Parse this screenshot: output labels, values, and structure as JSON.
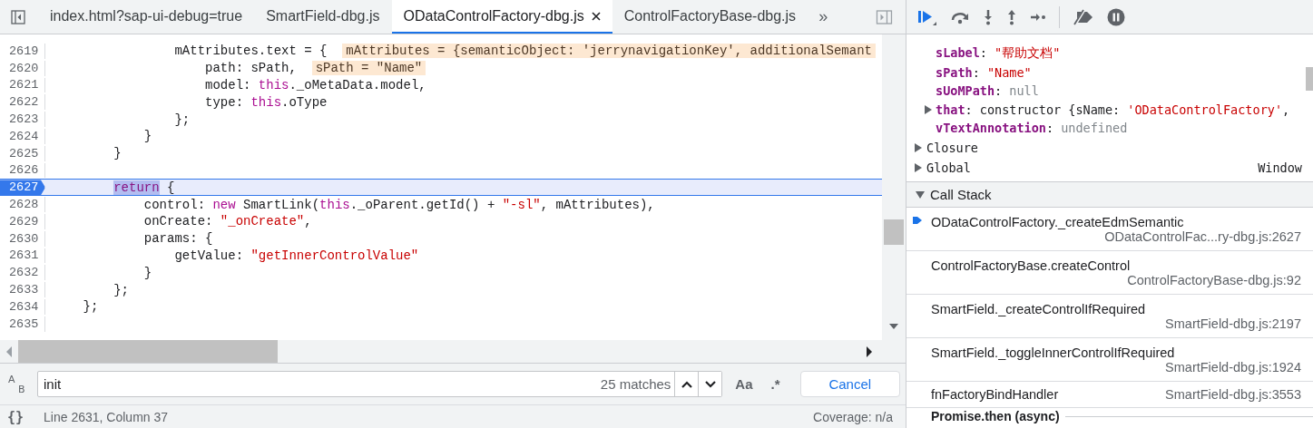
{
  "tabs": [
    {
      "label": "index.html?sap-ui-debug=true",
      "selected": false,
      "closable": false
    },
    {
      "label": "SmartField-dbg.js",
      "selected": false,
      "closable": false
    },
    {
      "label": "ODataControlFactory-dbg.js",
      "selected": true,
      "closable": true
    },
    {
      "label": "ControlFactoryBase-dbg.js",
      "selected": false,
      "closable": false
    }
  ],
  "more_tabs": "»",
  "code": [
    {
      "number": "2619",
      "paused": false,
      "breakpoint": false,
      "tokens": [
        {
          "kind": "plain",
          "text": "                mAttributes.text = {  "
        },
        {
          "kind": "inline",
          "text": "mAttributes = {semanticObject: 'jerrynavigationKey', additionalSemant"
        }
      ]
    },
    {
      "number": "2620",
      "paused": false,
      "breakpoint": false,
      "tokens": [
        {
          "kind": "plain",
          "text": "                    path: sPath,  "
        },
        {
          "kind": "inline",
          "text": "sPath = \"Name\""
        }
      ]
    },
    {
      "number": "2621",
      "paused": false,
      "breakpoint": false,
      "tokens": [
        {
          "kind": "plain",
          "text": "                    model: "
        },
        {
          "kind": "keyword",
          "text": "this"
        },
        {
          "kind": "plain",
          "text": "._oMetaData.model,"
        }
      ]
    },
    {
      "number": "2622",
      "paused": false,
      "breakpoint": false,
      "tokens": [
        {
          "kind": "plain",
          "text": "                    type: "
        },
        {
          "kind": "keyword",
          "text": "this"
        },
        {
          "kind": "plain",
          "text": ".oType"
        }
      ]
    },
    {
      "number": "2623",
      "paused": false,
      "breakpoint": false,
      "tokens": [
        {
          "kind": "plain",
          "text": "                };"
        }
      ]
    },
    {
      "number": "2624",
      "paused": false,
      "breakpoint": false,
      "tokens": [
        {
          "kind": "plain",
          "text": "            }"
        }
      ]
    },
    {
      "number": "2625",
      "paused": false,
      "breakpoint": false,
      "tokens": [
        {
          "kind": "plain",
          "text": "        }"
        }
      ]
    },
    {
      "number": "2626",
      "paused": false,
      "breakpoint": false
    },
    {
      "number": "2627",
      "paused": true,
      "breakpoint": true,
      "tokens": [
        {
          "kind": "match",
          "text": "        return"
        },
        {
          "kind": "plain",
          "text": " {"
        }
      ]
    },
    {
      "number": "2628",
      "paused": false,
      "breakpoint": false,
      "tokens": [
        {
          "kind": "plain",
          "text": "            control: "
        },
        {
          "kind": "keyword",
          "text": "new"
        },
        {
          "kind": "plain",
          "text": " SmartLink("
        },
        {
          "kind": "keyword",
          "text": "this"
        },
        {
          "kind": "plain",
          "text": "._oParent.getId() + "
        },
        {
          "kind": "string",
          "text": "\"-sl\""
        },
        {
          "kind": "plain",
          "text": ", mAttributes),"
        }
      ]
    },
    {
      "number": "2629",
      "paused": false,
      "breakpoint": false,
      "tokens": [
        {
          "kind": "plain",
          "text": "            onCreate: "
        },
        {
          "kind": "string",
          "text": "\"_onCreate\""
        },
        {
          "kind": "plain",
          "text": ","
        }
      ]
    },
    {
      "number": "2630",
      "paused": false,
      "breakpoint": false,
      "tokens": [
        {
          "kind": "plain",
          "text": "            params: {"
        }
      ]
    },
    {
      "number": "2631",
      "paused": false,
      "breakpoint": false,
      "tokens": [
        {
          "kind": "plain",
          "text": "                getValue: "
        },
        {
          "kind": "string",
          "text": "\"getInnerControlValue\""
        }
      ]
    },
    {
      "number": "2632",
      "paused": false,
      "breakpoint": false,
      "tokens": [
        {
          "kind": "plain",
          "text": "            }"
        }
      ]
    },
    {
      "number": "2633",
      "paused": false,
      "breakpoint": false,
      "tokens": [
        {
          "kind": "plain",
          "text": "        };"
        }
      ]
    },
    {
      "number": "2634",
      "paused": false,
      "breakpoint": false,
      "tokens": [
        {
          "kind": "plain",
          "text": "    };"
        }
      ]
    },
    {
      "number": "2635",
      "paused": false,
      "breakpoint": false
    }
  ],
  "search": {
    "replace_toggle": [
      "A",
      "B"
    ],
    "value": "init",
    "matches": "25 matches",
    "case_button": "Aa",
    "regex_button": ".*",
    "cancel": "Cancel"
  },
  "status_bar": {
    "format_button": "{}",
    "position": "Line 2631, Column 37",
    "coverage": "Coverage: n/a"
  },
  "scope": [
    {
      "name": "sLabel",
      "expandable": false,
      "value": [
        {
          "kind": "plain",
          "text": ": "
        },
        {
          "kind": "string",
          "text": "\"帮助文档\""
        }
      ]
    },
    {
      "name": "sPath",
      "expandable": false,
      "value": [
        {
          "kind": "plain",
          "text": ": "
        },
        {
          "kind": "string",
          "text": "\"Name\""
        }
      ]
    },
    {
      "name": "sUoMPath",
      "expandable": false,
      "value": [
        {
          "kind": "plain",
          "text": ": "
        },
        {
          "kind": "null",
          "text": "null"
        }
      ]
    },
    {
      "name": "that",
      "expandable": true,
      "value": [
        {
          "kind": "plain",
          "text": ": constructor {sName: "
        },
        {
          "kind": "string",
          "text": "'ODataControlFactory'"
        },
        {
          "kind": "plain",
          "text": ","
        }
      ]
    },
    {
      "name": "vTextAnnotation",
      "expandable": false,
      "value": [
        {
          "kind": "plain",
          "text": ": "
        },
        {
          "kind": "null",
          "text": "undefined"
        }
      ]
    }
  ],
  "scope_sections": [
    {
      "label": "Closure"
    },
    {
      "label": "Global",
      "value": "Window"
    }
  ],
  "call_stack": {
    "title": "Call Stack",
    "expanded": true,
    "frames": [
      {
        "function": "ODataControlFactory._createEdmSemantic",
        "location": "ODataControlFac...ry-dbg.js:2627",
        "selected": true,
        "inline": false
      },
      {
        "function": "ControlFactoryBase.createControl",
        "location": "ControlFactoryBase-dbg.js:92",
        "selected": false,
        "inline": false
      },
      {
        "function": "SmartField._createControlIfRequired",
        "location": "SmartField-dbg.js:2197",
        "selected": false,
        "inline": false
      },
      {
        "function": "SmartField._toggleInnerControlIfRequired",
        "location": "SmartField-dbg.js:1924",
        "selected": false,
        "inline": false
      },
      {
        "function": "fnFactoryBindHandler",
        "location": "SmartField-dbg.js:3553",
        "selected": false,
        "inline": true
      }
    ],
    "async_label": "Promise.then (async)"
  }
}
